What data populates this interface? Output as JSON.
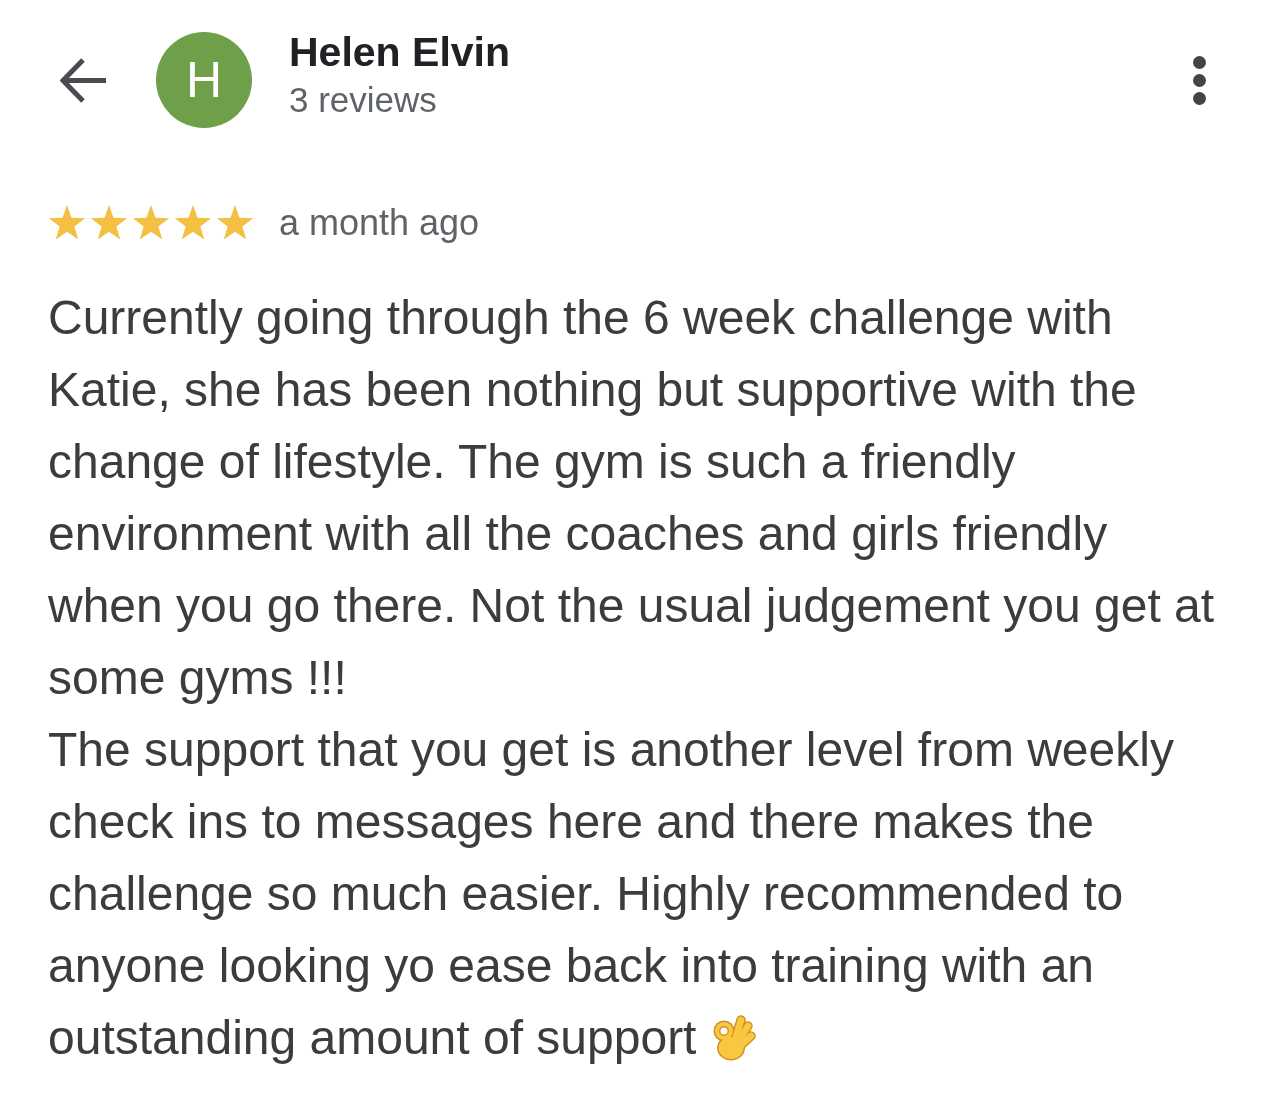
{
  "header": {
    "avatar_letter": "H",
    "name": "Helen Elvin",
    "review_count": "3 reviews"
  },
  "review": {
    "stars": 5,
    "time": "a month ago",
    "paragraphs": [
      "Currently going through the 6 week challenge with Katie, she has been nothing but supportive with the change of lifestyle. The gym is such a friendly environment with all the coaches and girls friendly when you go there. Not the usual judgement you get at some gyms !!!",
      "The support that you get is another level from weekly check ins to messages here and there makes the challenge so much easier. Highly recommended to anyone looking yo ease back into training with an"
    ],
    "last_line": "outstanding amount of support"
  }
}
